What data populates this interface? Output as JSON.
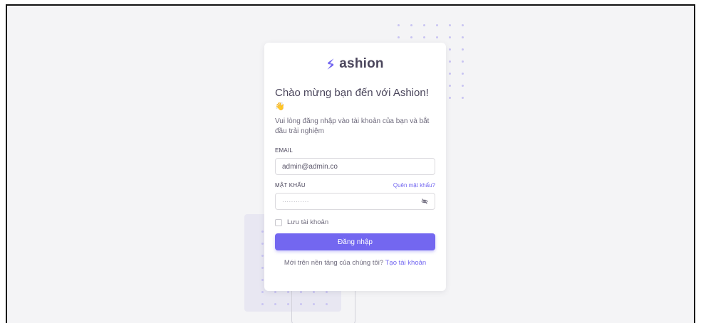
{
  "brand": {
    "name": "ashion",
    "accent_color": "#7367F0"
  },
  "login": {
    "welcome_title": "Chào mừng bạn đến với Ashion!",
    "welcome_emoji": "👋",
    "subtitle": "Vui lòng đăng nhập vào tài khoản của bạn và bắt đầu trải nghiệm",
    "email_label": "EMAIL",
    "email_value": "admin@admin.co",
    "password_label": "MẬT KHẨU",
    "forgot_password": "Quên mật khẩu?",
    "password_masked": "············",
    "remember_label": "Lưu tài khoản",
    "remember_checked": false,
    "submit_label": "Đăng nhập",
    "signup_prompt": "Mới trên nền tảng của chúng tôi?",
    "signup_link": "Tạo tài khoản"
  },
  "icons": {
    "brand": "brand-s-icon",
    "password_toggle": "eye-off-icon"
  }
}
